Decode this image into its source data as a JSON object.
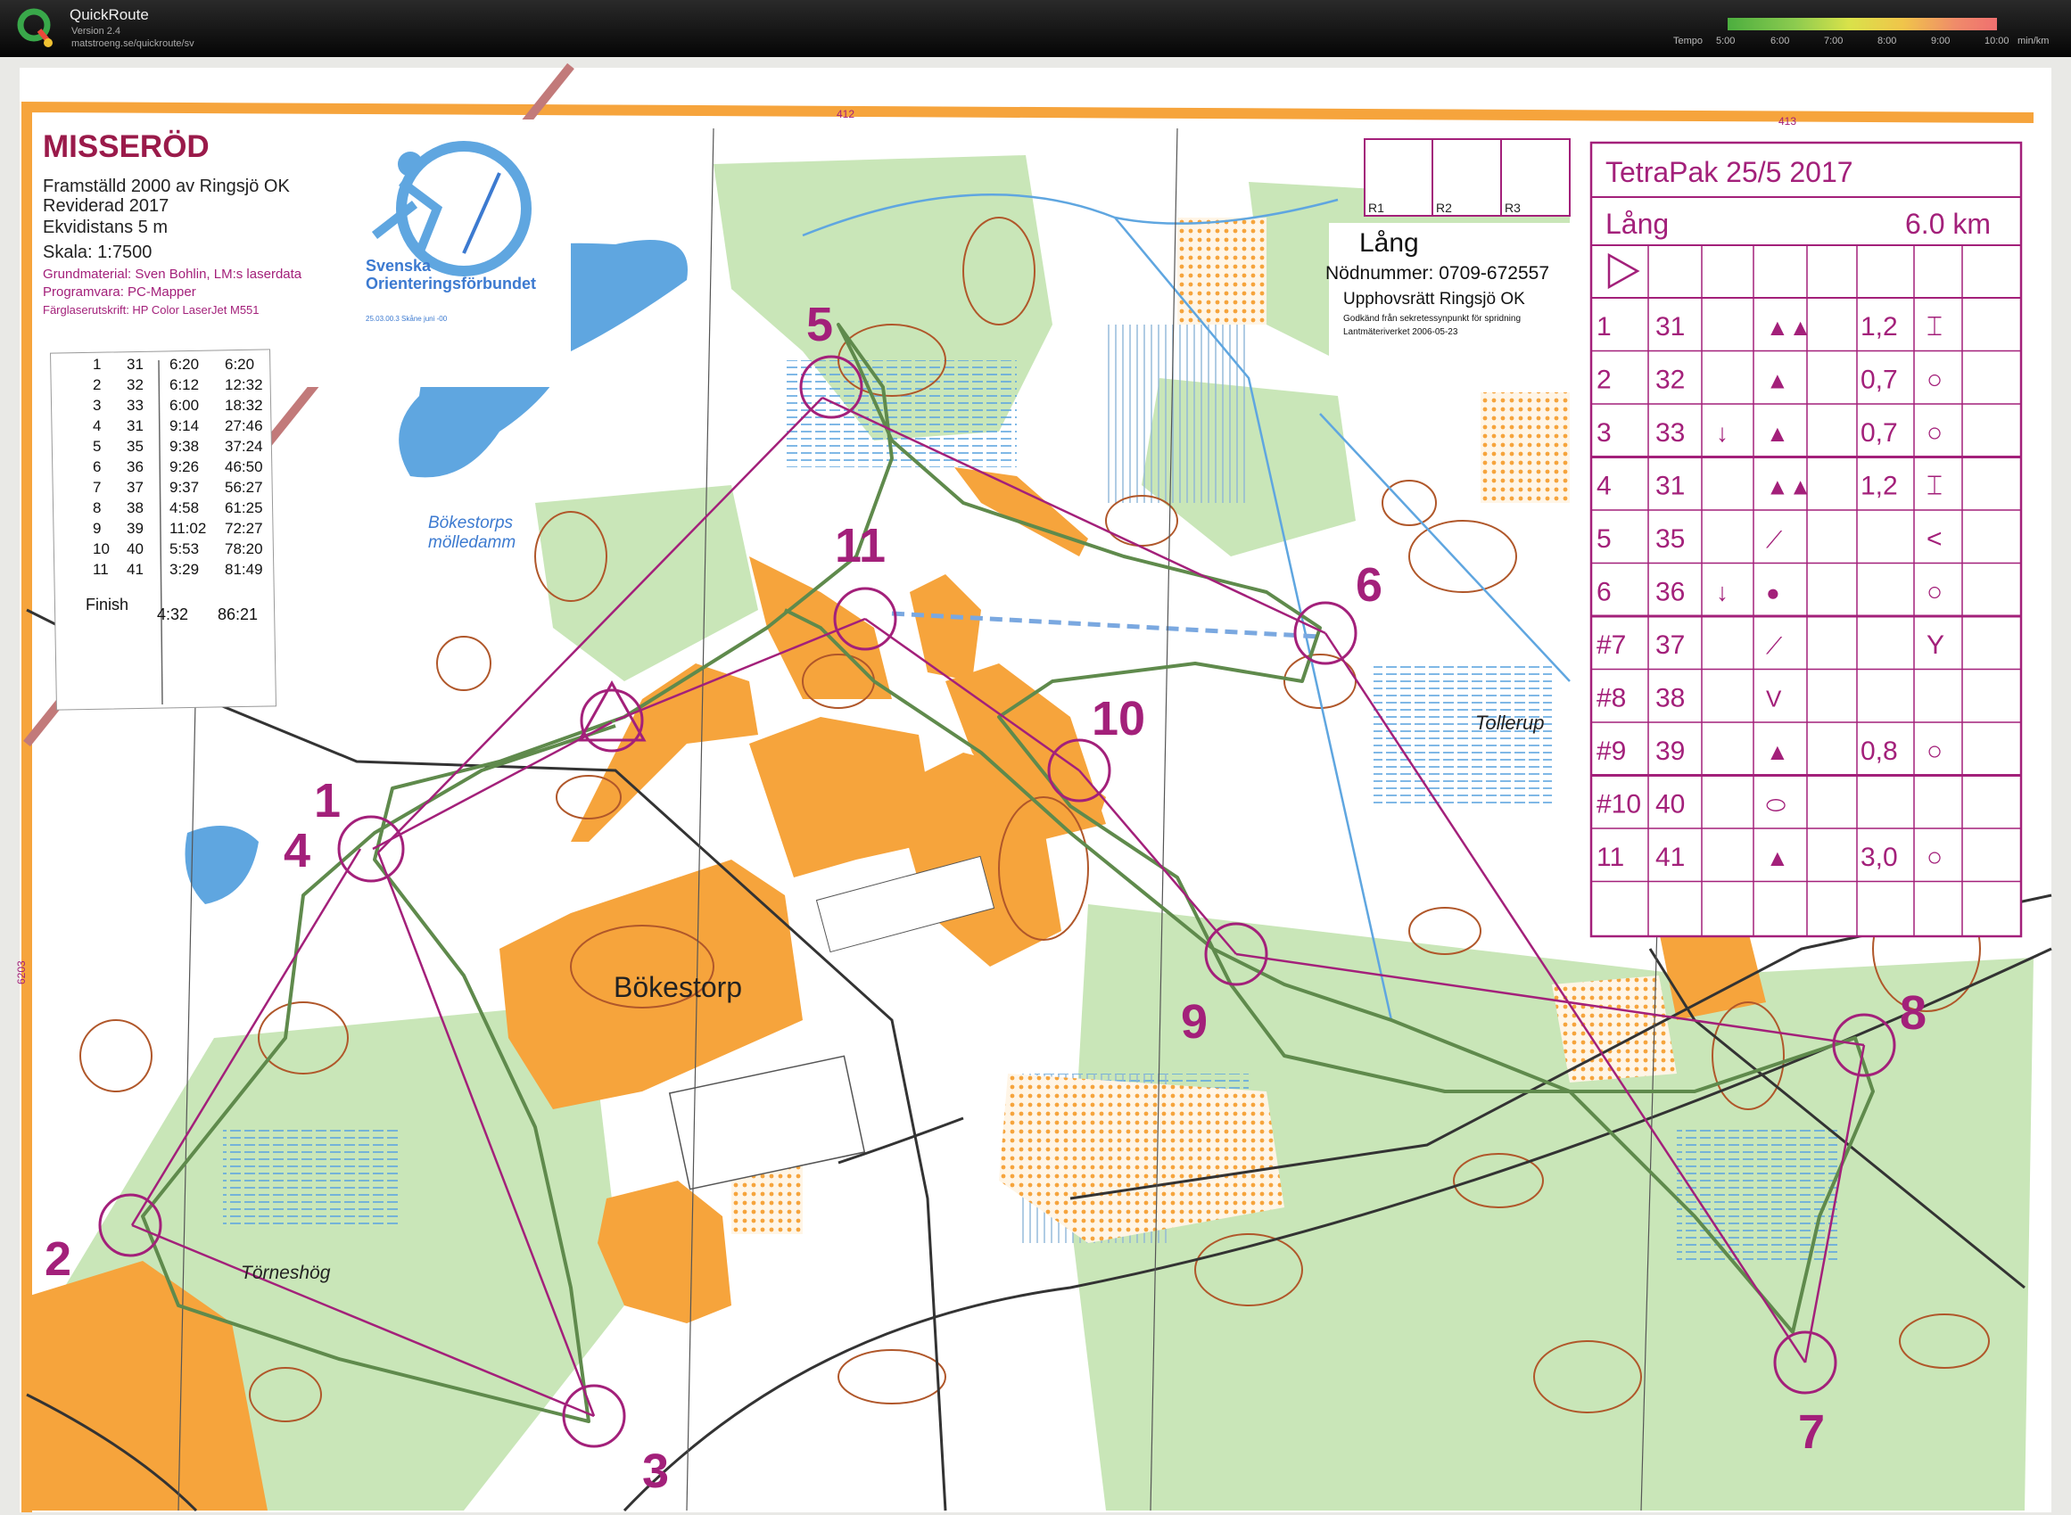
{
  "app": {
    "name": "QuickRoute",
    "version": "Version 2.4",
    "url": "matstroeng.se/quickroute/sv"
  },
  "tempo_scale": {
    "label": "Tempo",
    "ticks": [
      "5:00",
      "6:00",
      "7:00",
      "8:00",
      "9:00",
      "10:00"
    ],
    "unit": "min/km"
  },
  "map_header": {
    "title": "MISSERÖD",
    "lines": [
      "Framställd 2000 av Ringsjö OK",
      "Reviderad 2017",
      "Ekvidistans 5 m",
      "Skala:  1:7500"
    ],
    "small_lines": [
      "Grundmaterial: Sven Bohlin, LM:s laserdata",
      "Programvara: PC-Mapper",
      "Färglaserutskrift: HP Color LaserJet M551"
    ]
  },
  "federation": {
    "name1": "Svenska",
    "name2": "Orienteringsförbundet",
    "sub": "25.03.00.3 Skåne juni -00"
  },
  "ref_numbers": {
    "a": "412",
    "b": "413",
    "c": "6203"
  },
  "relay_boxes": [
    "R1",
    "R2",
    "R3"
  ],
  "course_info": {
    "course": "Lång",
    "phone": "Nödnummer: 0709-672557",
    "copyright": "Upphovsrätt Ringsjö OK",
    "approval1": "Godkänd från sekretessynpunkt för spridning",
    "approval2": "Lantmäteriverket 2006-05-23"
  },
  "control_card": {
    "title": "TetraPak 25/5 2017",
    "course": "Lång",
    "length": "6.0 km",
    "rows": [
      {
        "n": "1",
        "code": "31",
        "dir": "",
        "feat": "▲▲",
        "size": "1,2",
        "det": "⌶"
      },
      {
        "n": "2",
        "code": "32",
        "dir": "",
        "feat": "▲",
        "size": "0,7",
        "det": "○"
      },
      {
        "n": "3",
        "code": "33",
        "dir": "↓",
        "feat": "▲",
        "size": "0,7",
        "det": "○"
      },
      {
        "n": "4",
        "code": "31",
        "dir": "",
        "feat": "▲▲",
        "size": "1,2",
        "det": "⌶"
      },
      {
        "n": "5",
        "code": "35",
        "dir": "",
        "feat": "⟋",
        "size": "",
        "det": "<"
      },
      {
        "n": "6",
        "code": "36",
        "dir": "↓",
        "feat": "●",
        "size": "",
        "det": "○"
      },
      {
        "n": "#7",
        "code": "37",
        "dir": "",
        "feat": "⟋",
        "size": "",
        "det": "Y"
      },
      {
        "n": "#8",
        "code": "38",
        "dir": "",
        "feat": "V",
        "size": "",
        "det": ""
      },
      {
        "n": "#9",
        "code": "39",
        "dir": "",
        "feat": "▲",
        "size": "0,8",
        "det": "○"
      },
      {
        "n": "#10",
        "code": "40",
        "dir": "",
        "feat": "⬭",
        "size": "",
        "det": ""
      },
      {
        "n": "11",
        "code": "41",
        "dir": "",
        "feat": "▲",
        "size": "3,0",
        "det": "○"
      }
    ]
  },
  "splits": {
    "header": "",
    "rows": [
      [
        "1",
        "31",
        "6:20",
        "6:20"
      ],
      [
        "2",
        "32",
        "6:12",
        "12:32"
      ],
      [
        "3",
        "33",
        "6:00",
        "18:32"
      ],
      [
        "4",
        "31",
        "9:14",
        "27:46"
      ],
      [
        "5",
        "35",
        "9:38",
        "37:24"
      ],
      [
        "6",
        "36",
        "9:26",
        "46:50"
      ],
      [
        "7",
        "37",
        "9:37",
        "56:27"
      ],
      [
        "8",
        "38",
        "4:58",
        "61:25"
      ],
      [
        "9",
        "39",
        "11:02",
        "72:27"
      ],
      [
        "10",
        "40",
        "5:53",
        "78:20"
      ],
      [
        "11",
        "41",
        "3:29",
        "81:49"
      ]
    ],
    "finish_label": "Finish",
    "finish_split": "4:32",
    "finish_total": "86:21"
  },
  "place_names": {
    "lake1": "Bökestorps",
    "lake2": "mölledamm",
    "village": "Bökestorp",
    "farm": "Törneshög",
    "east": "Tollerup"
  },
  "control_labels": [
    "1",
    "2",
    "3",
    "4",
    "5",
    "6",
    "7",
    "8",
    "9",
    "10",
    "11"
  ],
  "colors": {
    "course": "#a3207a",
    "orange": "#f6a43c",
    "route": "#5f8a4c",
    "water": "#5fa6e0",
    "contour": "#b0572a"
  }
}
